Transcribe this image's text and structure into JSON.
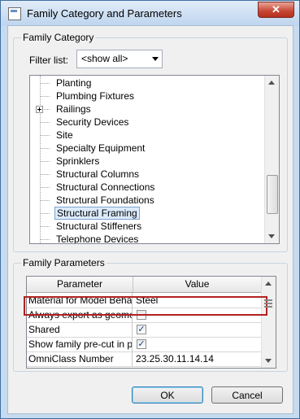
{
  "window": {
    "title": "Family Category and Parameters",
    "close_label": "✕"
  },
  "category": {
    "group_label": "Family Category",
    "filter_label": "Filter list:",
    "filter_value": "<show all>",
    "items": [
      {
        "label": "Planting",
        "expandable": false
      },
      {
        "label": "Plumbing Fixtures",
        "expandable": false
      },
      {
        "label": "Railings",
        "expandable": true
      },
      {
        "label": "Security Devices",
        "expandable": false
      },
      {
        "label": "Site",
        "expandable": false
      },
      {
        "label": "Specialty Equipment",
        "expandable": false
      },
      {
        "label": "Sprinklers",
        "expandable": false
      },
      {
        "label": "Structural Columns",
        "expandable": false
      },
      {
        "label": "Structural Connections",
        "expandable": false
      },
      {
        "label": "Structural Foundations",
        "expandable": false
      },
      {
        "label": "Structural Framing",
        "expandable": false,
        "selected": true
      },
      {
        "label": "Structural Stiffeners",
        "expandable": false
      },
      {
        "label": "Telephone Devices",
        "expandable": false
      }
    ]
  },
  "parameters": {
    "group_label": "Family Parameters",
    "columns": [
      "Parameter",
      "Value"
    ],
    "rows": [
      {
        "name": "Material for Model Beha",
        "value": "Steel",
        "kind": "text"
      },
      {
        "name": "Always export as geome",
        "value": "",
        "kind": "checkbox",
        "checked": false
      },
      {
        "name": "Shared",
        "value": "",
        "kind": "checkbox",
        "checked": true
      },
      {
        "name": "Show family pre-cut in p",
        "value": "",
        "kind": "checkbox",
        "checked": true
      },
      {
        "name": "OmniClass Number",
        "value": "23.25.30.11.14.14",
        "kind": "text"
      }
    ]
  },
  "buttons": {
    "ok": "OK",
    "cancel": "Cancel"
  },
  "colors": {
    "highlight": "#b22222",
    "selection": "#dcebfc"
  }
}
